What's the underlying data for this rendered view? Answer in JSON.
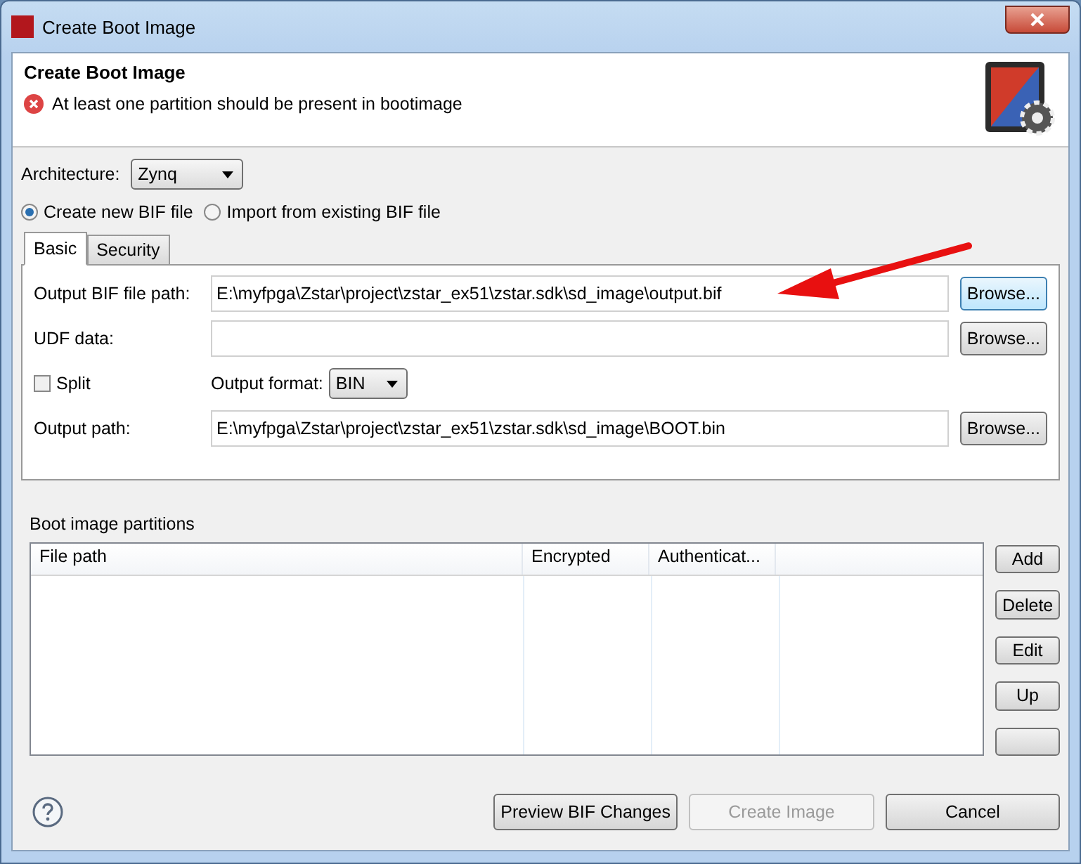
{
  "window": {
    "title": "Create Boot Image"
  },
  "header": {
    "title": "Create Boot Image",
    "error": "At least one partition should be present in bootimage"
  },
  "architecture": {
    "label": "Architecture:",
    "value": "Zynq"
  },
  "bif_mode": [
    {
      "label": "Create new BIF file",
      "selected": true
    },
    {
      "label": "Import from existing BIF file",
      "selected": false
    }
  ],
  "tabs": [
    {
      "label": "Basic",
      "selected": true
    },
    {
      "label": "Security",
      "selected": false
    }
  ],
  "rows": [
    {
      "kind": "path",
      "label": "Output BIF file path:",
      "value": "E:\\myfpga\\Zstar\\project\\zstar_ex51\\zstar.sdk\\sd_image\\output.bif",
      "button": "Browse...",
      "focused": true
    },
    {
      "kind": "path",
      "label": "UDF data:",
      "value": "",
      "button": "Browse...",
      "focused": false
    },
    {
      "kind": "split",
      "label": "Split",
      "checked": false,
      "format_label": "Output format:",
      "format_value": "BIN"
    },
    {
      "kind": "path",
      "label": "Output path:",
      "value": "E:\\myfpga\\Zstar\\project\\zstar_ex51\\zstar.sdk\\sd_image\\BOOT.bin",
      "button": "Browse...",
      "focused": false
    }
  ],
  "partitions": {
    "title": "Boot image partitions",
    "columns": [
      "File path",
      "Encrypted",
      "Authenticat..."
    ],
    "buttons": [
      "Add",
      "Delete",
      "Edit",
      "Up"
    ]
  },
  "footer": [
    {
      "label": "Preview BIF Changes",
      "disabled": false
    },
    {
      "label": "Create Image",
      "disabled": true
    },
    {
      "label": "Cancel",
      "disabled": false
    }
  ]
}
